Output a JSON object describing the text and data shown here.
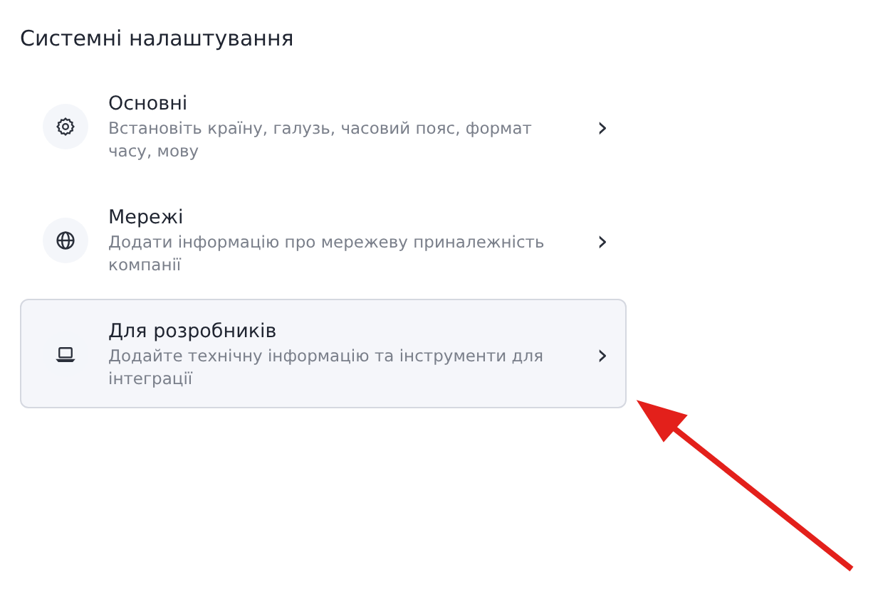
{
  "title": "Системні налаштування",
  "items": [
    {
      "kind": "gear",
      "label": "Основні",
      "description": "Встановіть країну, галузь, часовий пояс, формат часу, мову",
      "chevron": "›",
      "selected": false
    },
    {
      "kind": "globe",
      "label": "Мережі",
      "description": "Додати інформацію про мережеву приналежність компанії",
      "chevron": "›",
      "selected": false
    },
    {
      "kind": "laptop",
      "label": "Для розробників",
      "description": "Додайте технічну інформацію та інструменти для інтеграції",
      "chevron": "›",
      "selected": true
    }
  ]
}
